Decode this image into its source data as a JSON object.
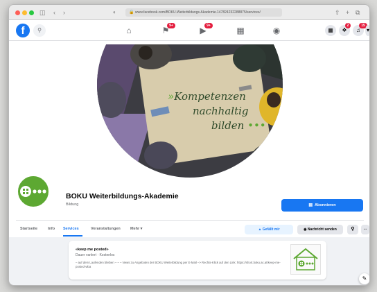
{
  "browser": {
    "url": "www.facebook.com/BOKU.Weiterbildungs.Akademie.147824232288875/services/"
  },
  "nav": {
    "notification_badge": "9+",
    "watch_badge": "9+",
    "messenger_badge": "2",
    "bell_badge": "15"
  },
  "cover": {
    "line1": "Kompetenzen",
    "line2": "nachhaltig",
    "line3": "bilden"
  },
  "page": {
    "name": "BOKU Weiterbildungs-Akademie",
    "category": "Bildung",
    "subscribe_label": "Abonnieren"
  },
  "tabs": [
    "Startseite",
    "Info",
    "Services",
    "Veranstaltungen",
    "Mehr ▾"
  ],
  "actions": {
    "like_label": "Gefällt mir",
    "message_label": "Nachricht senden"
  },
  "service": {
    "title": "«keep me posted»",
    "meta": "Dauer variiert · Kostenlos",
    "description": "– auf dem Laufenden bleiben – – – News zu Angeboten der BOKU Weiterbildung per E-Mail –> Rechts-Klick auf den Link: https://short.boku.ac.at/keep-me-posted-wba"
  },
  "colors": {
    "fb_blue": "#1877f2",
    "boku_green": "#5da832",
    "badge_red": "#e41e3f"
  }
}
